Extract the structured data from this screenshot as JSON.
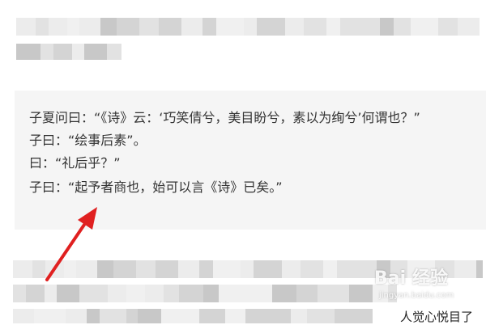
{
  "quote_box": {
    "lines": [
      "子夏问曰：“《诗》云：‘巧笑倩兮，美目盼兮，素以为绚兮’何谓也？”",
      "子曰：“绘事后素”。",
      "曰：“礼后乎？”",
      "子曰：“起予者商也，始可以言《诗》已矣。”"
    ]
  },
  "partial_text": "人觉心悦目了",
  "watermark": {
    "brand": "Bai 经验",
    "sub": "jingyan.baidu.com"
  },
  "colors": {
    "quote_background": "#f5f5f5",
    "quote_text": "#333333",
    "arrow": "#e02020",
    "pixelation": [
      "#d4d4d4",
      "#e2e2e2",
      "#ececec",
      "#c8c8c8",
      "#f0f0f0"
    ]
  },
  "icons": {
    "annotation": "red-arrow-icon",
    "logo": "baidu-paw-icon"
  }
}
